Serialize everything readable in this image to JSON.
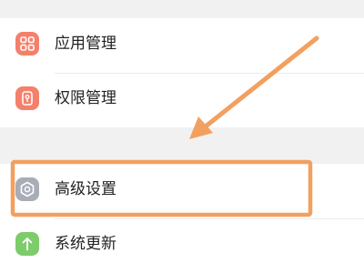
{
  "settings": {
    "items": [
      {
        "label": "应用管理",
        "icon": "app-grid-icon",
        "color": "#f4806c"
      },
      {
        "label": "权限管理",
        "icon": "permission-lock-icon",
        "color": "#f4806c"
      },
      {
        "label": "高级设置",
        "icon": "gear-icon",
        "color": "#a9adb6"
      },
      {
        "label": "系统更新",
        "icon": "update-arrow-icon",
        "color": "#7ccc6a"
      }
    ]
  },
  "annotation": {
    "color": "#f2a060",
    "highlighted_item": "高级设置"
  }
}
